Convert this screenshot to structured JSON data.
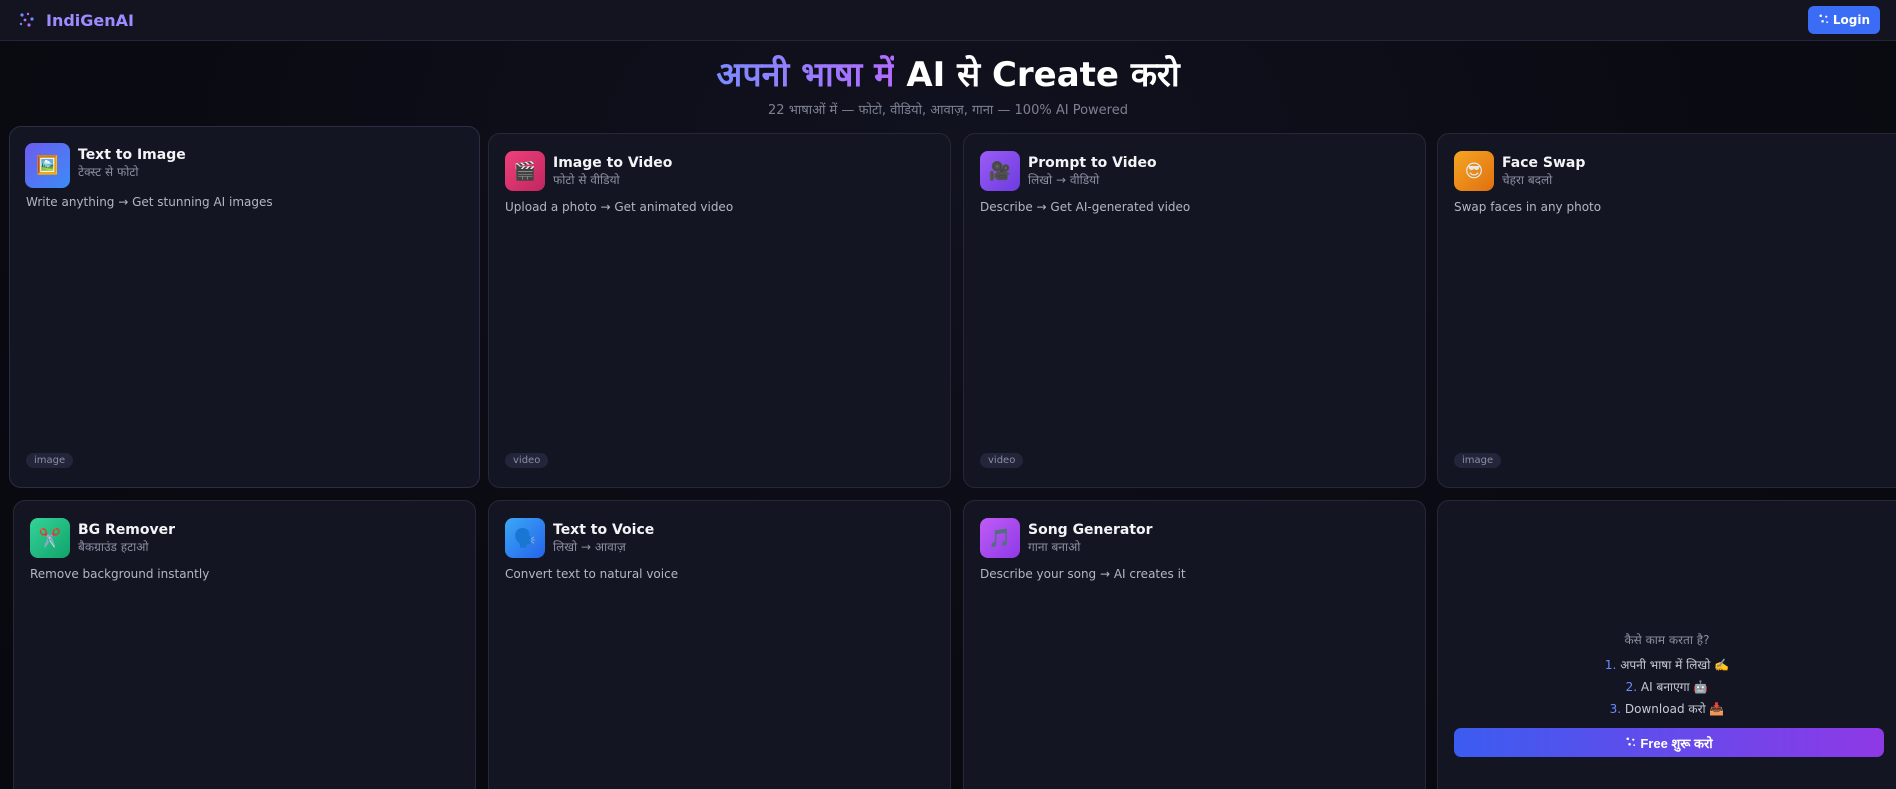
{
  "header": {
    "brand": "IndiGenAI",
    "login_label": "Login"
  },
  "hero": {
    "title_part1": "अपनी भाषा में",
    "title_part2": "AI से Create करो",
    "subtitle": "22 भाषाओं में — फोटो, वीडियो, आवाज़, गाना — 100% AI Powered"
  },
  "cards": [
    {
      "title": "Text to Image",
      "subtitle": "टेक्स्ट से फोटो",
      "desc": "Write anything → Get stunning AI images",
      "tag": "image",
      "icon": "picture-icon"
    },
    {
      "title": "Image to Video",
      "subtitle": "फोटो से वीडियो",
      "desc": "Upload a photo → Get animated video",
      "tag": "video",
      "icon": "clapperboard-icon"
    },
    {
      "title": "Prompt to Video",
      "subtitle": "लिखो → वीडियो",
      "desc": "Describe → Get AI-generated video",
      "tag": "video",
      "icon": "movie-camera-icon"
    },
    {
      "title": "Face Swap",
      "subtitle": "चेहरा बदलो",
      "desc": "Swap faces in any photo",
      "tag": "image",
      "icon": "face-icon"
    },
    {
      "title": "BG Remover",
      "subtitle": "बैकग्राउंड हटाओ",
      "desc": "Remove background instantly",
      "icon": "scissors-icon"
    },
    {
      "title": "Text to Voice",
      "subtitle": "लिखो → आवाज़",
      "desc": "Convert text to natural voice",
      "icon": "speaking-head-icon"
    },
    {
      "title": "Song Generator",
      "subtitle": "गाना बनाओ",
      "desc": "Describe your song → AI creates it",
      "icon": "music-note-icon"
    }
  ],
  "how": {
    "title": "कैसे काम करता है?",
    "steps": [
      {
        "num": "1.",
        "text": "अपनी भाषा में लिखो ✍️"
      },
      {
        "num": "2.",
        "text": "AI बनाएगा 🤖"
      },
      {
        "num": "3.",
        "text": "Download करो 📥"
      }
    ],
    "cta_label": "Free शुरू करो"
  },
  "colors": {
    "background": "#0b0b14",
    "card": "#141522",
    "accent_blue": "#3b6cf6",
    "accent_purple": "#8e39e6"
  }
}
